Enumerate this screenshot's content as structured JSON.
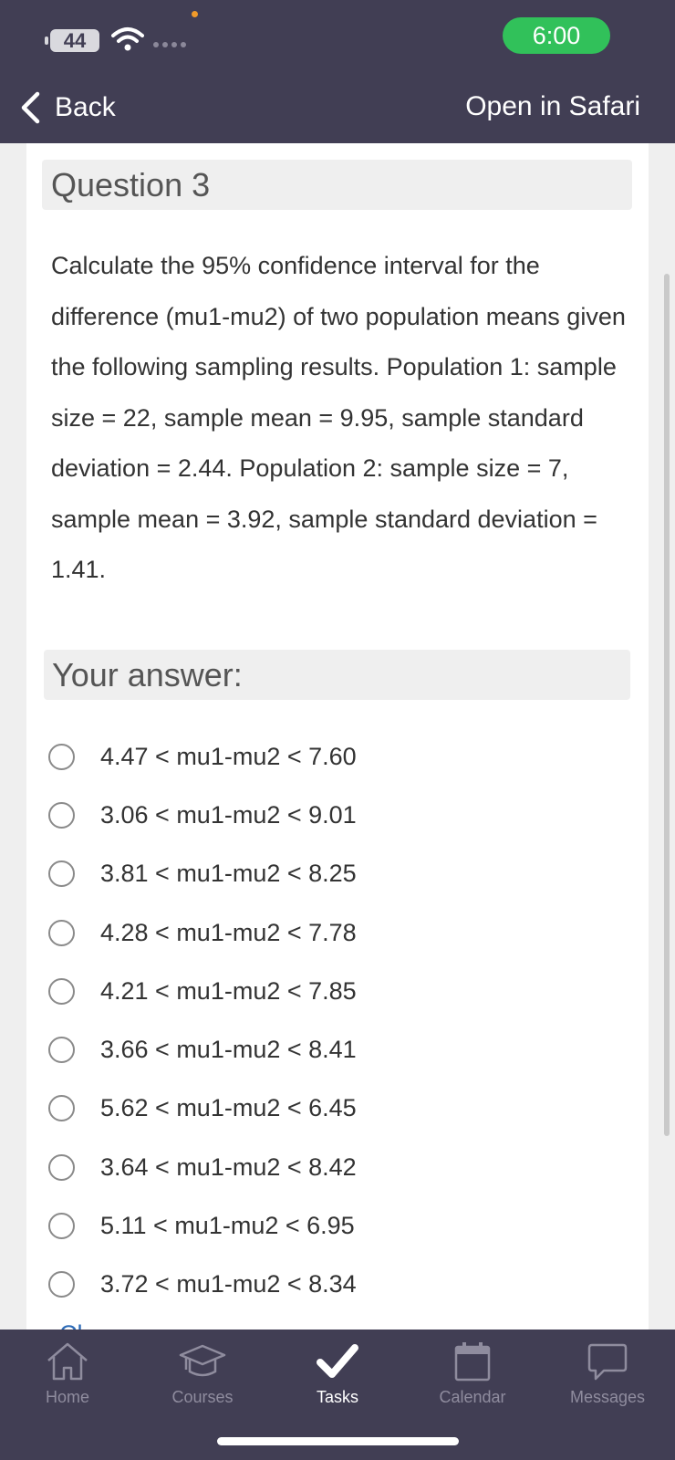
{
  "status_bar": {
    "battery": "44",
    "time": "6:00"
  },
  "nav": {
    "back_label": "Back",
    "open_label": "Open in Safari"
  },
  "question": {
    "title": "Question 3",
    "text": "Calculate the 95% confidence interval for the difference (mu1-mu2) of two population means given the following sampling results. Population 1: sample size = 22, sample mean = 9.95, sample standard deviation = 2.44. Population 2: sample size = 7, sample mean = 3.92, sample standard deviation = 1.41."
  },
  "answer": {
    "title": "Your answer:",
    "options": [
      "4.47 < mu1-mu2 < 7.60",
      "3.06 < mu1-mu2 < 9.01",
      "3.81 < mu1-mu2 < 8.25",
      "4.28 < mu1-mu2 < 7.78",
      "4.21 < mu1-mu2 < 7.85",
      "3.66 < mu1-mu2 < 8.41",
      "5.62 < mu1-mu2 < 6.45",
      "3.64 < mu1-mu2 < 8.42",
      "5.11 < mu1-mu2 < 6.95",
      "3.72 < mu1-mu2 < 8.34"
    ],
    "partial_link": "Cl"
  },
  "tabbar": {
    "tabs": [
      {
        "label": "Home",
        "icon": "home-icon"
      },
      {
        "label": "Courses",
        "icon": "graduation-cap-icon"
      },
      {
        "label": "Tasks",
        "icon": "checkmark-icon"
      },
      {
        "label": "Calendar",
        "icon": "calendar-icon"
      },
      {
        "label": "Messages",
        "icon": "chat-bubble-icon"
      }
    ],
    "active": "Tasks"
  },
  "colors": {
    "header_bg": "#413e54",
    "status_time_bg": "#31c15a",
    "link": "#2c6bb7"
  }
}
